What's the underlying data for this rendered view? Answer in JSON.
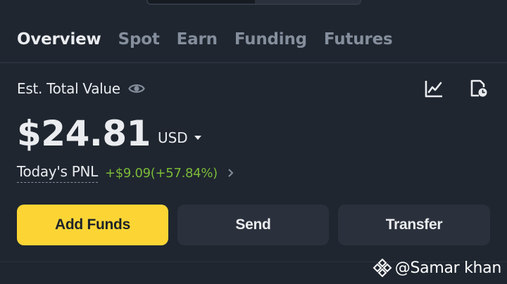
{
  "tabs": [
    {
      "label": "Overview",
      "active": true
    },
    {
      "label": "Spot",
      "active": false
    },
    {
      "label": "Earn",
      "active": false
    },
    {
      "label": "Funding",
      "active": false
    },
    {
      "label": "Futures",
      "active": false
    }
  ],
  "balance": {
    "label": "Est. Total Value",
    "amount": "$24.81",
    "currency": "USD",
    "pnl_label": "Today's PNL",
    "pnl_value": "+$9.09(+57.84%)"
  },
  "actions": {
    "add_funds": "Add Funds",
    "send": "Send",
    "transfer": "Transfer"
  },
  "watermark": {
    "text": "@Samar khan"
  },
  "icons": {
    "visibility": "eye-icon",
    "chart": "line-chart-icon",
    "history": "history-icon",
    "currency_dropdown": "caret-down-icon",
    "pnl_details": "chevron-right-icon",
    "watermark_logo": "binance-logo-icon"
  },
  "colors": {
    "background": "#1f2630",
    "accent": "#fcd535",
    "positive": "#7cbb38",
    "muted": "#848e9c",
    "secondary_button": "#2b313c"
  }
}
